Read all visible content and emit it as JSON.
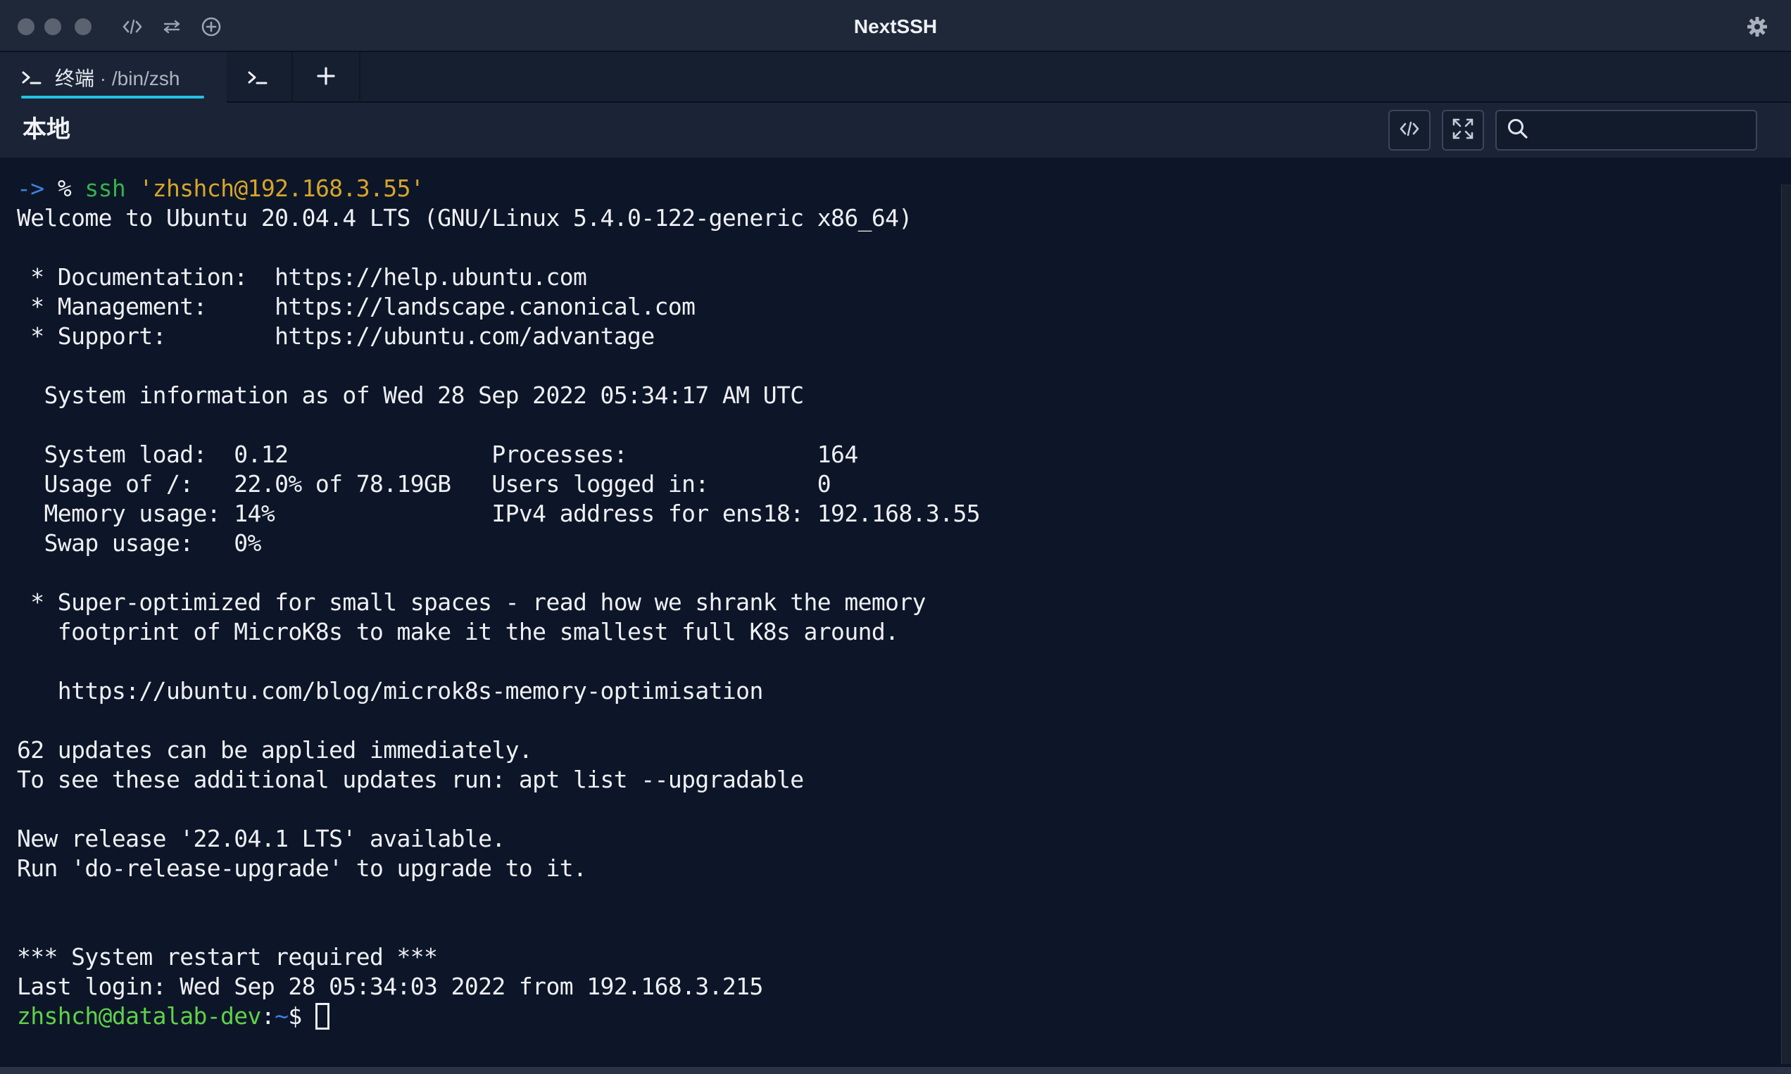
{
  "window": {
    "title": "NextSSH",
    "toolbar_icons": [
      "code-icon",
      "transfer-icon",
      "add-circle-icon"
    ],
    "settings_icon": "gear-icon"
  },
  "tabs": [
    {
      "label": "终端",
      "separator": " · ",
      "subtitle": "/bin/zsh",
      "icon": "terminal-prompt-icon",
      "active": true
    },
    {
      "label": "",
      "icon": "terminal-prompt-icon",
      "active": false
    }
  ],
  "add_tab_icon": "plus-icon",
  "host": {
    "title": "本地",
    "buttons": [
      "code-icon",
      "expand-icon"
    ],
    "search": {
      "value": "",
      "placeholder": ""
    }
  },
  "terminal": {
    "prompt": {
      "arrow": "->",
      "symbol": "%",
      "command": "ssh",
      "argument": "'zhshch@192.168.3.55'"
    },
    "lines": [
      "Welcome to Ubuntu 20.04.4 LTS (GNU/Linux 5.4.0-122-generic x86_64)",
      "",
      " * Documentation:  https://help.ubuntu.com",
      " * Management:     https://landscape.canonical.com",
      " * Support:        https://ubuntu.com/advantage",
      "",
      "  System information as of Wed 28 Sep 2022 05:34:17 AM UTC",
      "",
      "  System load:  0.12               Processes:              164",
      "  Usage of /:   22.0% of 78.19GB   Users logged in:        0",
      "  Memory usage: 14%                IPv4 address for ens18: 192.168.3.55",
      "  Swap usage:   0%",
      "",
      " * Super-optimized for small spaces - read how we shrank the memory",
      "   footprint of MicroK8s to make it the smallest full K8s around.",
      "",
      "   https://ubuntu.com/blog/microk8s-memory-optimisation",
      "",
      "62 updates can be applied immediately.",
      "To see these additional updates run: apt list --upgradable",
      "",
      "New release '22.04.1 LTS' available.",
      "Run 'do-release-upgrade' to upgrade to it.",
      "",
      "",
      "*** System restart required ***",
      "Last login: Wed Sep 28 05:34:03 2022 from 192.168.3.215"
    ],
    "remote_prompt": {
      "user_host": "zhshch@datalab-dev",
      "colon": ":",
      "path": "~",
      "symbol": "$ "
    }
  }
}
